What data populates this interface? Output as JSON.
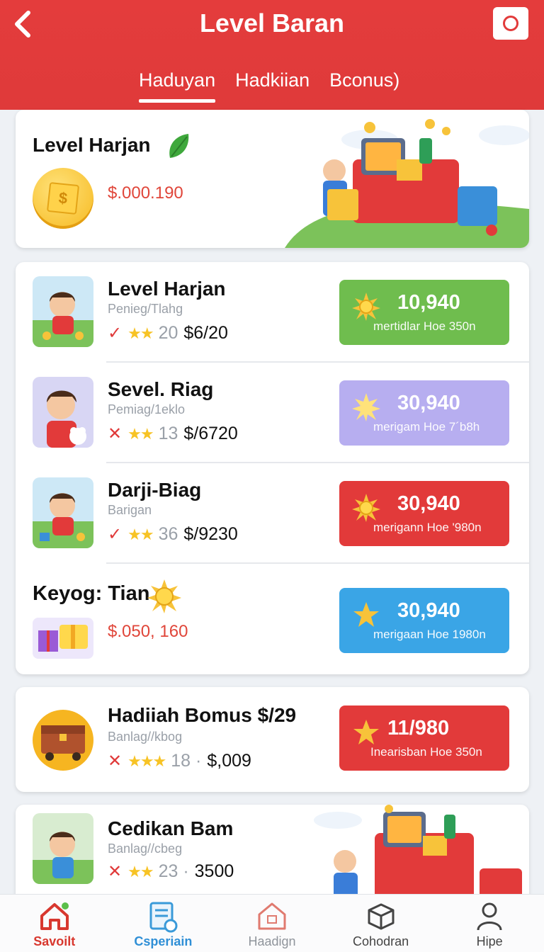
{
  "header": {
    "title": "Level Baran",
    "tabs": [
      {
        "label": "Haduyan",
        "active": true
      },
      {
        "label": "Hadkiian",
        "active": false
      },
      {
        "label": "Bconus)",
        "active": false
      }
    ]
  },
  "top_card": {
    "title": "Level Harjan",
    "amount": "$.000.190",
    "coin_symbol": "$"
  },
  "rows": [
    {
      "title": "Level Harjan",
      "sub": "Penieg/Tlahg",
      "mark": "✓",
      "stars": "★★",
      "num": "20",
      "price": "$6/20",
      "reward_value": "10,940",
      "reward_sub": "mertidlar Hoe 350n",
      "reward_color": "#6fbd4e"
    },
    {
      "title": "Sevel. Riag",
      "sub": "Pemiag/1eklo",
      "mark": "✕",
      "stars": "★★",
      "num": "13",
      "price": "$/6720",
      "reward_value": "30,940",
      "reward_sub": "merigam Hoe 7´b8h",
      "reward_color": "#b7aef0"
    },
    {
      "title": "Darji-Biag",
      "sub": "Barigan",
      "mark": "✓",
      "stars": "★★",
      "num": "36",
      "price": "$/9230",
      "reward_value": "30,940",
      "reward_sub": "merigann Hoe '980n",
      "reward_color": "#e23a3a"
    }
  ],
  "keyog": {
    "title": "Keyog: Tian",
    "amount": "$.050, 160",
    "reward_value": "30,940",
    "reward_sub": "merigaan Hoe 1980n",
    "reward_color": "#3aa5e6"
  },
  "bonus_row": {
    "title": "Hadiiah Bomus $/29",
    "sub": "Banlag//kbog",
    "mark": "✕",
    "stars": "★★★",
    "num": "18 ·",
    "price": "$,009",
    "reward_value": "11/980",
    "reward_sub": "Inearisban Hoe 350n",
    "reward_color": "#e23a3a"
  },
  "last_row": {
    "title": "Cedikan Bam",
    "sub": "Banlag//cbeg",
    "mark": "✕",
    "stars": "★★",
    "num": "23 ·",
    "price": "3500"
  },
  "bottom_nav": [
    {
      "label": "Savoilt",
      "icon": "home-icon"
    },
    {
      "label": "Csperiain",
      "icon": "document-icon"
    },
    {
      "label": "Haadign",
      "icon": "house-outline-icon"
    },
    {
      "label": "Cohodran",
      "icon": "box-icon"
    },
    {
      "label": "Hipe",
      "icon": "user-icon"
    }
  ]
}
